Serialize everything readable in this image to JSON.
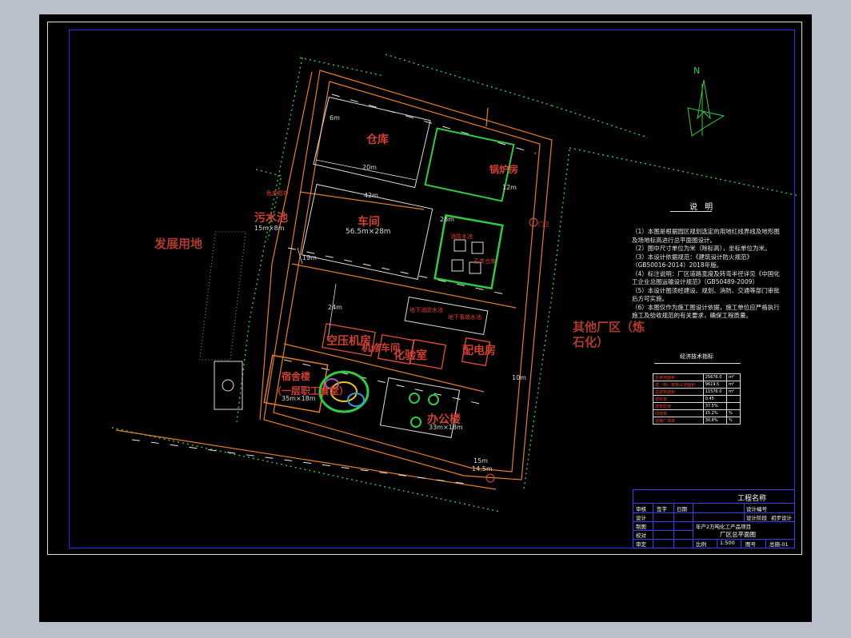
{
  "drawing": {
    "north": "N",
    "plots": {
      "development_land": "发展用地",
      "other_plant_area": "其他厂区（炼",
      "other_plant_area_2": "石化）"
    },
    "buildings": {
      "warehouse": "仓库",
      "workshop": "车间",
      "workshop_size": "56.5m×28m",
      "boiler_room": "锅炉房",
      "sewage_pool": "污水池",
      "sewage_size": "15m×8m",
      "dorm": "宿舍楼",
      "dorm_sub": "（一层职工食堂）",
      "dorm_size": "35m×18m",
      "office": "办公楼",
      "office_size": "33m×18m",
      "power_room": "配电房",
      "lab": "化验室",
      "pump_room": "空压机房",
      "boiler_small": "机修车间"
    },
    "small_tags": [
      "危废暂存",
      "消防水池",
      "乙类仓库",
      "地下消防水池",
      "地下事故水池",
      "门卫"
    ],
    "dims": [
      "20m",
      "42m",
      "19m",
      "24m",
      "28m",
      "15m",
      "14.5m",
      "10m",
      "6m",
      "12m"
    ]
  },
  "notes": {
    "title": "说 明",
    "items": [
      "（1）本图是根据园区规划选定的用地红线界线及地形图及场地标高进行总平面图设计。",
      "（2）图中尺寸单位为米（除标高），坐标单位为米。",
      "（3）本设计依据规范：《建筑设计防火规范》（GB50016-2014）2018年版。",
      "（4）标注说明：厂区道路宽度及转弯半径详见《中国化工企业总图运输设计规范》（GB50489-2009）",
      "（5）本设计图须经建设、规划、消防、交通等部门审批后方可实施。",
      "（6）本图仅作为施工图设计依据，施工单位应严格执行施工及验收规范的有关要求，确保工程质量。"
    ]
  },
  "econ_table": {
    "title": "经济技术指标",
    "rows": [
      {
        "name": "总用地面积",
        "value": "25676.0",
        "unit": "m²"
      },
      {
        "name": "建（构）筑物占地面积",
        "value": "9619.5",
        "unit": "m²"
      },
      {
        "name": "总建筑面积",
        "value": "11576.0",
        "unit": "m²"
      },
      {
        "name": "容积率",
        "value": "0.45",
        "unit": ""
      },
      {
        "name": "建筑密度",
        "value": "37.5%",
        "unit": ""
      },
      {
        "name": "绿地率",
        "value": "15.2%",
        "unit": "%"
      },
      {
        "name": "道路广场率",
        "value": "30.8%",
        "unit": "%"
      }
    ]
  },
  "title_block": {
    "project_label": "工程名称",
    "rows_left": [
      "审核",
      "设计",
      "制图",
      "校对",
      "审定"
    ],
    "sign_labels": [
      "签字",
      "日期"
    ],
    "design_stage_label": "设计阶段",
    "design_stage": "初步设计",
    "drawing_no_label": "设计编号",
    "project_name": "年产2万吨化工产品项目",
    "drawing_name": "厂区总平面图",
    "scale_label": "比例",
    "scale": "1:500",
    "sheet_label": "图号",
    "sheet": "总施-01"
  }
}
